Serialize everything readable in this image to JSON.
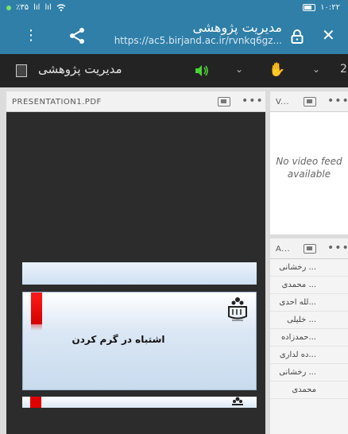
{
  "status_bar": {
    "left_text": "٪۳۵",
    "signal_1": "lıl",
    "signal_2": "lıl",
    "wifi": "wifi-icon",
    "time": "۱۰:۲۲"
  },
  "browser": {
    "page_title": "مدیریت پژوهشی",
    "url": "https://ac5.birjand.ac.ir/rvnkq6gz...",
    "menu_icon": "more-vertical-icon",
    "share_icon": "share-icon",
    "lock_icon": "lock-icon",
    "close_icon": "close-icon"
  },
  "toolbar": {
    "room_title": "مدیریت پژوهشی",
    "speaker_color": "#4cd137",
    "hand_icon": "raise-hand-icon",
    "count": "2"
  },
  "share_pod": {
    "title": "PRESENTATION1.PDF",
    "slide_title": "اشتباه در گرم کردن"
  },
  "video_pod": {
    "title": "V...",
    "no_video_text": "No video feed available"
  },
  "attendees_pod": {
    "title": "A...",
    "items": [
      "... رخشانی",
      "... محمدی",
      "...لله احدی",
      "... خلیلی",
      "...حمدزاده",
      "...ده لداری",
      "... رخشانی",
      "محمدی"
    ]
  },
  "colors": {
    "header_blue": "#2f7fa8",
    "toolbar_dark": "#232323",
    "slide_red": "#e00000"
  }
}
